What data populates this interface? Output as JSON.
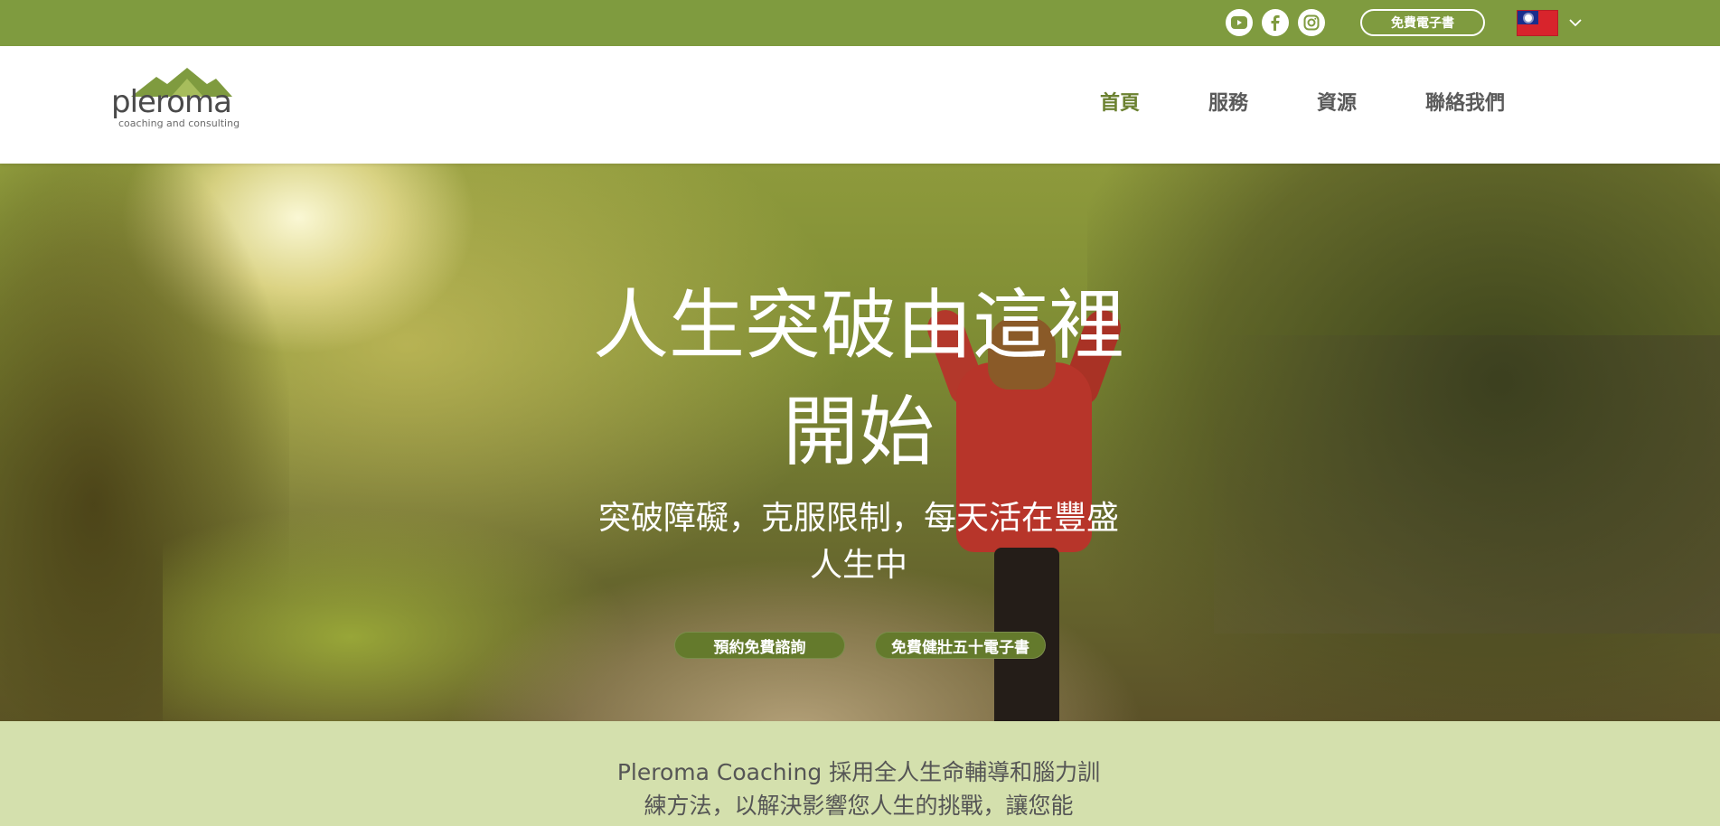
{
  "topbar": {
    "social": [
      {
        "icon": "youtube-icon"
      },
      {
        "icon": "facebook-icon"
      },
      {
        "icon": "instagram-icon"
      }
    ],
    "ebook_button": "免費電子書",
    "language": {
      "flag": "taiwan-flag-icon",
      "chevron": "chevron-down-icon"
    },
    "background": "#7f9b3f"
  },
  "header": {
    "logo": {
      "word": "pleroma",
      "tagline": "coaching and consulting"
    },
    "nav": [
      {
        "label": "首頁",
        "active": true
      },
      {
        "label": "服務",
        "active": false
      },
      {
        "label": "資源",
        "active": false
      },
      {
        "label": "聯絡我們",
        "active": false
      }
    ]
  },
  "hero": {
    "title": "人生突破由這裡開始",
    "subtitle": "突破障礙，克服限制，每天活在豐盛人生中",
    "cta_primary": "預約免費諮詢",
    "cta_secondary": "免費健壯五十電子書"
  },
  "intro": {
    "text": "Pleroma Coaching 採用全人生命輔導和腦力訓練方法，以解決影響您人生的挑戰，讓您能"
  },
  "colors": {
    "accent": "#6b8130",
    "button": "#647a2c",
    "intro_bg": "#d4e0ad"
  }
}
